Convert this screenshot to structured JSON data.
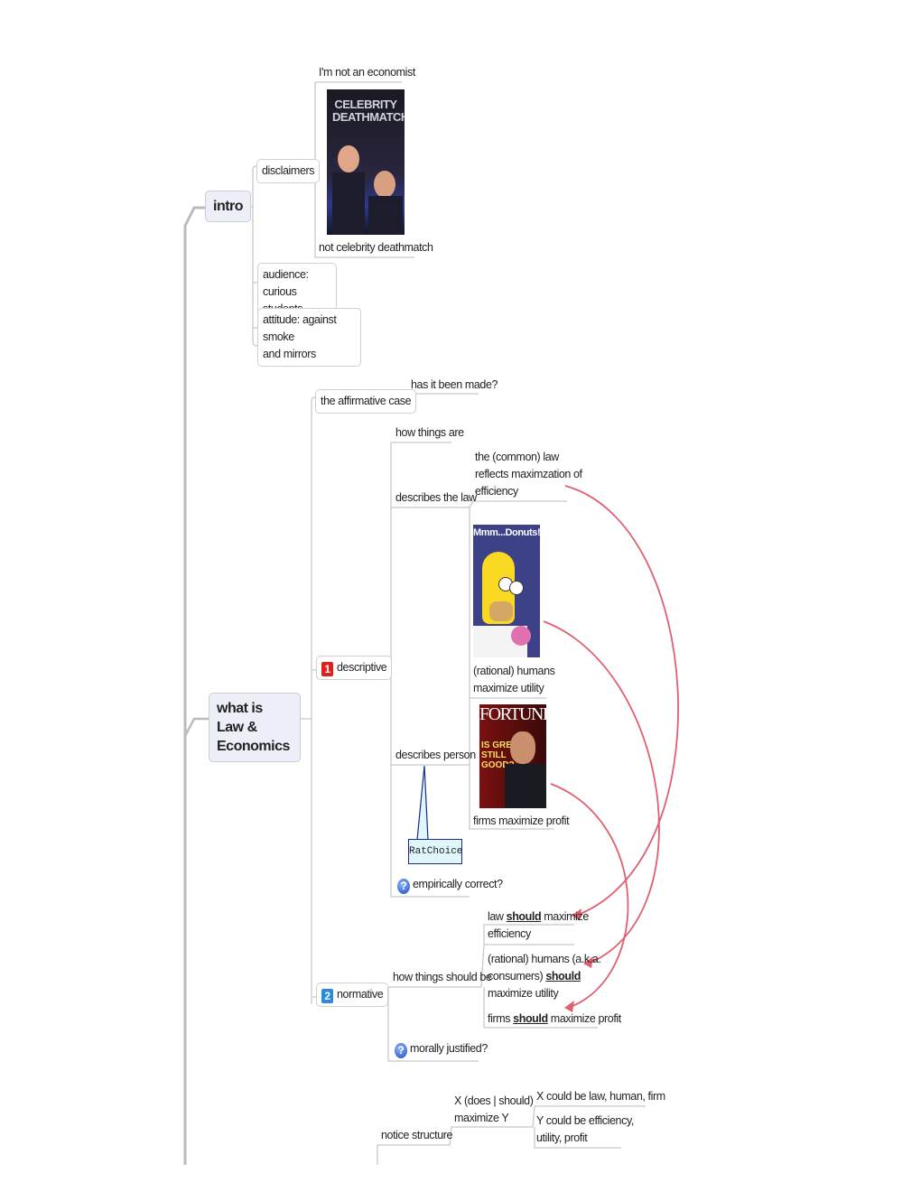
{
  "colors": {
    "branch": "#c8c8c8",
    "relationship": "#e06070",
    "main_fill": "#eceef8",
    "callout_fill": "#dff6fb",
    "callout_border": "#1a2a8a",
    "badge1": "#e0201c",
    "badge2": "#2a8ae0"
  },
  "intro": {
    "label": "intro",
    "disclaimers": {
      "label": "disclaimers",
      "image_title": "I'm not an economist",
      "image_caption": "not celebrity deathmatch",
      "image_logo": "CELEBRITY DEATHMATCH"
    },
    "audience": {
      "line1": "audience: curious",
      "line2": "students"
    },
    "attitude": {
      "line1": "attitude:  against smoke",
      "line2": "and mirrors"
    }
  },
  "law_econ": {
    "line1": "what is Law &",
    "line2": "Economics",
    "affirmative": {
      "label": "the affirmative case",
      "child": "has it been made?"
    },
    "descriptive": {
      "badge": "1",
      "label": "descriptive",
      "how_things_are": "how things are",
      "describes_law": {
        "label": "describes the law",
        "child": [
          "the (common) law",
          "reflects maximzation of",
          "efficiency"
        ]
      },
      "describes_person": {
        "label": "describes person",
        "humans_image_logo": "Mmm...Donuts!",
        "humans": [
          "(rational) humans",
          "maximize utility"
        ],
        "firms_image_logo": "FORTUNE",
        "firms_image_headline": [
          "IS GREED",
          "STILL",
          "GOOD?"
        ],
        "firms": "firms maximize profit"
      },
      "callout": "RatChoice",
      "question_icon": "question-icon",
      "empirical": "empirically correct?"
    },
    "normative": {
      "badge": "2",
      "label": "normative",
      "how_things_should_be": "how things should be",
      "law": {
        "pre": "law ",
        "should": "should",
        "post": " maximize",
        "line2": "efficiency"
      },
      "humans": {
        "line1": "(rational) humans (a.k.a.",
        "pre": "consumers) ",
        "should": "should",
        "line3": "maximize utility"
      },
      "firms": {
        "pre": "firms ",
        "should": "should",
        "post": " maximize profit"
      },
      "moral": "morally justified?"
    },
    "notice": {
      "label": "notice structure",
      "child": [
        "X (does | should)",
        "maximize Y"
      ],
      "grandchildren": [
        "X could be law, human, firm",
        "Y could be efficiency,",
        "utility, profit"
      ]
    }
  }
}
